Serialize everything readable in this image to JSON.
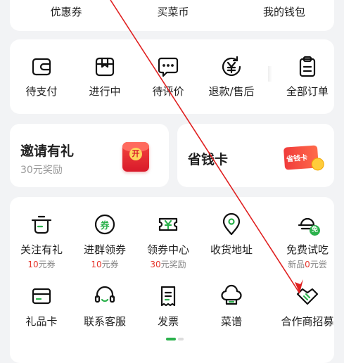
{
  "wallet_row": {
    "coupon": "优惠券",
    "coin": "买菜币",
    "wallet": "我的钱包"
  },
  "orders": {
    "items": [
      {
        "label": "待支付",
        "icon": "wallet-icon"
      },
      {
        "label": "进行中",
        "icon": "package-icon"
      },
      {
        "label": "待评价",
        "icon": "comment-icon"
      },
      {
        "label": "退款/售后",
        "icon": "refund-icon"
      },
      {
        "label": "全部订单",
        "icon": "clipboard-icon"
      }
    ]
  },
  "promo": {
    "invite_title": "邀请有礼",
    "invite_sub": "30元奖励",
    "invite_badge": "开",
    "savings_title": "省钱卡",
    "savings_badge": "省钱卡"
  },
  "services": {
    "row1": [
      {
        "label": "关注有礼",
        "sub_num": "10",
        "sub_unit": "元券",
        "icon": "pot-icon"
      },
      {
        "label": "进群领券",
        "sub_num": "10",
        "sub_unit": "元券",
        "icon": "coupon-circle-icon",
        "icon_text": "券"
      },
      {
        "label": "领券中心",
        "sub_num": "30",
        "sub_unit": "元奖励",
        "icon": "yen-ticket-icon"
      },
      {
        "label": "收货地址",
        "icon": "location-pin-icon"
      },
      {
        "label": "免费试吃",
        "sub_prefix": "新品",
        "sub_num": "0",
        "sub_unit": "元尝",
        "icon": "free-dish-icon",
        "icon_text": "免"
      }
    ],
    "row2": [
      {
        "label": "礼品卡",
        "icon": "gift-card-icon"
      },
      {
        "label": "联系客服",
        "icon": "headset-icon"
      },
      {
        "label": "发票",
        "icon": "invoice-icon"
      },
      {
        "label": "菜谱",
        "icon": "chef-hat-icon"
      },
      {
        "label": "合作商招募",
        "icon": "handshake-icon"
      }
    ]
  },
  "colors": {
    "brand_green": "#2bb14c",
    "accent_red": "#e5352b",
    "annotation_arrow": "#e02020"
  }
}
